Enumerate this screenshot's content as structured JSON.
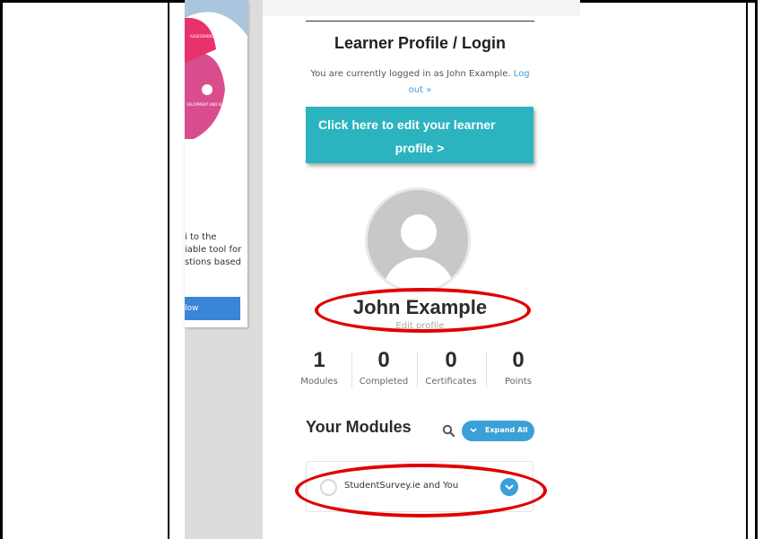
{
  "profile": {
    "title": "Learner Profile / Login",
    "logged_in_text": "You are currently logged in as John Example.",
    "logout_link": "Log out »",
    "edit_button_line1": "Click here to edit your learner",
    "edit_button_line2": "profile  >",
    "user_name": "John Example",
    "edit_profile_link": "Edit profile"
  },
  "stats": [
    {
      "value": "1",
      "label": "Modules"
    },
    {
      "value": "0",
      "label": "Completed"
    },
    {
      "value": "0",
      "label": "Certificates"
    },
    {
      "value": "0",
      "label": "Points"
    }
  ],
  "modules": {
    "heading": "Your Modules",
    "expand_label": "Expand All",
    "items": [
      {
        "title": "StudentSurvey.ie and You"
      }
    ]
  },
  "left_panel": {
    "text_lines": [
      "i to the",
      "iable tool for",
      "stions based"
    ],
    "button_label": "low",
    "graphic_labels": [
      "ASSESSMENT AND FEEDBACK",
      "VELOPMENT AND SUCCESS"
    ]
  },
  "colors": {
    "accent": "#2bb3c0",
    "link": "#3aa0d8",
    "annotation": "#e00000"
  }
}
